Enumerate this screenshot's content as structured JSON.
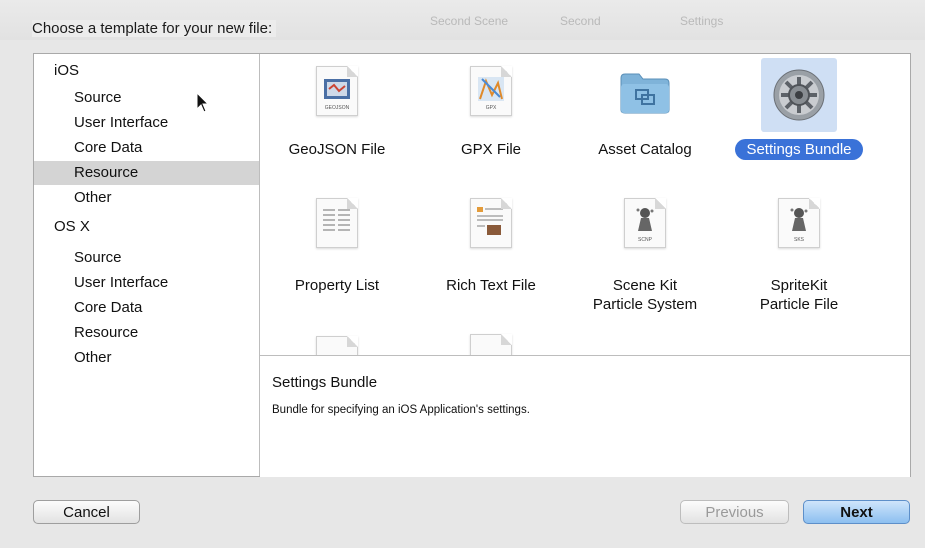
{
  "background_toolbar": {
    "texts": [
      "Second Scene",
      "Second",
      "Settings"
    ]
  },
  "dialog": {
    "prompt": "Choose a template for your new file:"
  },
  "sidebar": {
    "groups": [
      {
        "header": "iOS",
        "items": [
          "Source",
          "User Interface",
          "Core Data",
          "Resource",
          "Other"
        ]
      },
      {
        "header": "OS X",
        "items": [
          "Source",
          "User Interface",
          "Core Data",
          "Resource",
          "Other"
        ]
      }
    ],
    "selected": "iOS / Resource"
  },
  "templates": {
    "row1": [
      {
        "label": "GeoJSON File",
        "icon": "geojson-file-icon",
        "badge": "GEOJSON"
      },
      {
        "label": "GPX File",
        "icon": "gpx-file-icon",
        "badge": "GPX"
      },
      {
        "label": "Asset Catalog",
        "icon": "folder-icon"
      },
      {
        "label": "Settings Bundle",
        "icon": "gear-icon"
      }
    ],
    "row2": [
      {
        "label": "Property List",
        "icon": "property-list-icon"
      },
      {
        "label": "Rich Text File",
        "icon": "rich-text-icon"
      },
      {
        "label_line1": "Scene Kit",
        "label_line2": "Particle System",
        "icon": "scenekit-particle-icon",
        "badge": "SCNP"
      },
      {
        "label_line1": "SpriteKit",
        "label_line2": "Particle File",
        "icon": "spritekit-particle-icon",
        "badge": "SKS"
      }
    ],
    "selected": "Settings Bundle"
  },
  "description": {
    "title": "Settings Bundle",
    "body": "Bundle for specifying an iOS Application's settings."
  },
  "buttons": {
    "cancel": "Cancel",
    "previous": "Previous",
    "next": "Next"
  },
  "colors": {
    "selection_blue": "#3a72d8",
    "sidebar_selected": "#d4d4d4"
  }
}
